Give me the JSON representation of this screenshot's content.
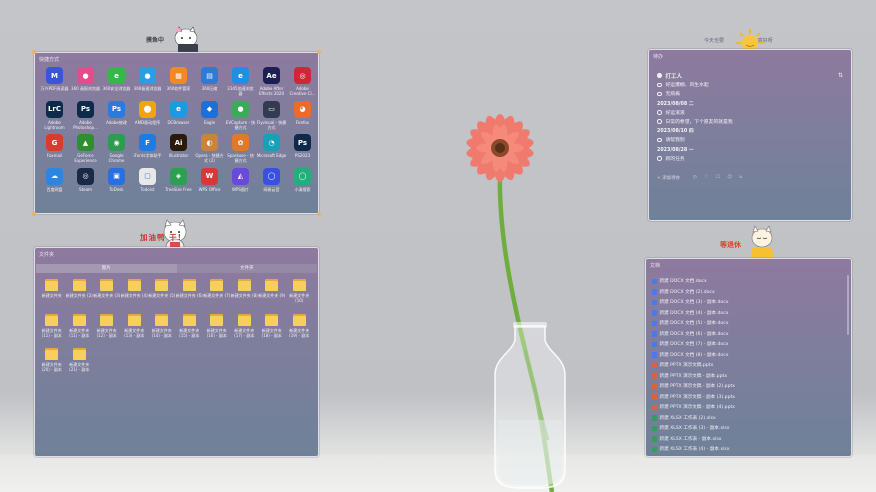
{
  "apps_panel": {
    "title": "快捷方式",
    "sticker": "摸鱼中",
    "items": [
      {
        "label": "万兴PDF阅读器",
        "icon": "M",
        "color": "#3a55d8"
      },
      {
        "label": "360 画报浏览器",
        "icon": "●",
        "color": "#e64b8c"
      },
      {
        "label": "360安全浏览器",
        "icon": "e",
        "color": "#35b84a"
      },
      {
        "label": "360极速浏览器",
        "icon": "●",
        "color": "#2a9de6"
      },
      {
        "label": "360软件管家",
        "icon": "▦",
        "color": "#f08a24"
      },
      {
        "label": "360压缩",
        "icon": "▤",
        "color": "#2d7bd6"
      },
      {
        "label": "2345加速浏览器",
        "icon": "e",
        "color": "#1f8fe0"
      },
      {
        "label": "Adobe After Effects 2020",
        "icon": "Ae",
        "color": "#1d1e54"
      },
      {
        "label": "Adobe Creative Cl...",
        "icon": "◎",
        "color": "#d3253a"
      },
      {
        "label": "Adobe Lightroom Classic",
        "icon": "LrC",
        "color": "#0c2b4a"
      },
      {
        "label": "Adobe Photoshop...",
        "icon": "Ps",
        "color": "#0e2a4a"
      },
      {
        "label": "Adobe修改",
        "icon": "Ps",
        "color": "#2a7ae0"
      },
      {
        "label": "AMD驱动程序",
        "icon": "⬤",
        "color": "#f2a30f"
      },
      {
        "label": "DCBrowser",
        "icon": "e",
        "color": "#1d9be0"
      },
      {
        "label": "Eagle",
        "icon": "◆",
        "color": "#1f6fd8"
      },
      {
        "label": "EVCapture - 快捷方式",
        "icon": "●",
        "color": "#3caa58"
      },
      {
        "label": "Flyvisual - 快捷方式",
        "icon": "▭",
        "color": "#333a52"
      },
      {
        "label": "Firefox",
        "icon": "◕",
        "color": "#ef6a2a"
      },
      {
        "label": "Foxmail",
        "icon": "G",
        "color": "#d93b2d"
      },
      {
        "label": "GeForce Experience",
        "icon": "▲",
        "color": "#2f8e2f"
      },
      {
        "label": "Google Chrome",
        "icon": "◉",
        "color": "#2e9b4e"
      },
      {
        "label": "iFonts字体助手",
        "icon": "F",
        "color": "#1e7be6"
      },
      {
        "label": "Illustrator",
        "icon": "Ai",
        "color": "#2a1a08"
      },
      {
        "label": "Opera - 快捷方式 (2)",
        "icon": "◐",
        "color": "#c8843a"
      },
      {
        "label": "Sparkuse - 快捷方式",
        "icon": "✿",
        "color": "#e07a2a"
      },
      {
        "label": "Microsoft Edge",
        "icon": "◔",
        "color": "#16a1b8"
      },
      {
        "label": "PS2023",
        "icon": "Ps",
        "color": "#0e2a4a"
      },
      {
        "label": "百度网盘",
        "icon": "☁",
        "color": "#2a86e0"
      },
      {
        "label": "Steam",
        "icon": "◎",
        "color": "#1b2a44"
      },
      {
        "label": "ToDesk",
        "icon": "▣",
        "color": "#2a6fe0"
      },
      {
        "label": "Todoist",
        "icon": "▢",
        "color": "#e8e8e8"
      },
      {
        "label": "TreeSize Free",
        "icon": "◈",
        "color": "#2aa050"
      },
      {
        "label": "WPS Office",
        "icon": "W",
        "color": "#d8383a"
      },
      {
        "label": "WPS图片",
        "icon": "◭",
        "color": "#6a4ad8"
      },
      {
        "label": "网易云音",
        "icon": "◯",
        "color": "#3a50e0"
      },
      {
        "label": "小清搜索",
        "icon": "◯",
        "color": "#22b07a"
      }
    ]
  },
  "files_panel": {
    "title": "文件夹",
    "sticker": "加油鸭 干!",
    "tabs": [
      "图片",
      "文件夹"
    ],
    "folders": [
      "新建文件夹",
      "新建文件夹 (2)",
      "新建文件夹 (3)",
      "新建文件夹 (4)",
      "新建文件夹 (5)",
      "新建文件夹 (6)",
      "新建文件夹 (7)",
      "新建文件夹 (8)",
      "新建文件夹 (9)",
      "新建文件夹 (10)",
      "新建文件夹 (11) - 副本",
      "新建文件夹 (11) - 副本",
      "新建文件夹 (12) - 副本",
      "新建文件夹 (13) - 副本",
      "新建文件夹 (14) - 副本",
      "新建文件夹 (15) - 副本",
      "新建文件夹 (16) - 副本",
      "新建文件夹 (17) - 副本",
      "新建文件夹 (18) - 副本",
      "新建文件夹 (19) - 副本",
      "新建文件夹 (20) - 副本",
      "新建文件夹 (21) - 副本"
    ]
  },
  "todo_panel": {
    "title": "待办",
    "sticker": "今天也要 真好呀",
    "rows": [
      {
        "type": "task",
        "text": "打工人"
      },
      {
        "type": "item",
        "text": "好运爆棚、风生水起"
      },
      {
        "type": "item",
        "text": "无病痛"
      },
      {
        "type": "section",
        "text": "2023/08/08 二"
      },
      {
        "type": "item",
        "text": "好运滚滚"
      },
      {
        "type": "item",
        "text": "日常的希望，下个愿友的就是我"
      },
      {
        "type": "section",
        "text": "2023/08/10 四"
      },
      {
        "type": "item",
        "text": "请帮我别"
      },
      {
        "type": "section",
        "text": "2023/08/28 一"
      },
      {
        "type": "item",
        "text": "新的任务"
      }
    ],
    "footer": "+ 添加待办"
  },
  "docs_panel": {
    "title": "文档",
    "sticker": "等退休",
    "files": [
      {
        "name": "新建 DOCX 文档.docx",
        "color": "#4a7ae8"
      },
      {
        "name": "新建 DOCX 文档 (2).docx",
        "color": "#4a7ae8"
      },
      {
        "name": "新建 DOCX 文档 (3) - 副本.docx",
        "color": "#4a7ae8"
      },
      {
        "name": "新建 DOCX 文档 (4) - 副本.docx",
        "color": "#4a7ae8"
      },
      {
        "name": "新建 DOCX 文档 (5) - 副本.docx",
        "color": "#4a7ae8"
      },
      {
        "name": "新建 DOCX 文档 (6) - 副本.docx",
        "color": "#4a7ae8"
      },
      {
        "name": "新建 DOCX 文档 (7) - 副本.docx",
        "color": "#4a7ae8"
      },
      {
        "name": "新建 DOCX 文档 (8) - 副本.docx",
        "color": "#4a7ae8"
      },
      {
        "name": "新建 PPTX 演示文稿.pptx",
        "color": "#e0603a"
      },
      {
        "name": "新建 PPTX 演示文稿 - 副本.pptx",
        "color": "#e0603a"
      },
      {
        "name": "新建 PPTX 演示文稿 - 副本 (2).pptx",
        "color": "#e0603a"
      },
      {
        "name": "新建 PPTX 演示文稿 - 副本 (3).pptx",
        "color": "#e0603a"
      },
      {
        "name": "新建 PPTX 演示文稿 - 副本 (4).pptx",
        "color": "#e0603a"
      },
      {
        "name": "新建 XLSX 工作表 (2).xlsx",
        "color": "#2fa05a"
      },
      {
        "name": "新建 XLSX 工作表 (3) - 副本.xlsx",
        "color": "#2fa05a"
      },
      {
        "name": "新建 XLSX 工作表 - 副本.xlsx",
        "color": "#2fa05a"
      },
      {
        "name": "新建 XLSX 工作表 (4) - 副本.xlsx",
        "color": "#2fa05a"
      }
    ]
  }
}
